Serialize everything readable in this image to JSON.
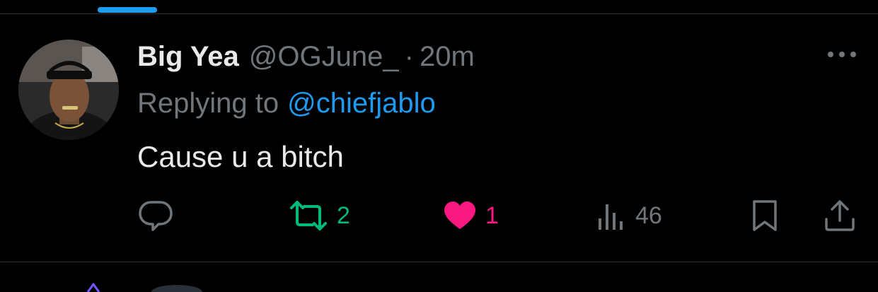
{
  "tweet": {
    "display_name": "Big Yea",
    "handle": "@OGJune_",
    "separator": "·",
    "time": "20m",
    "reply_prefix": "Replying to",
    "reply_mention": "@chiefjablo",
    "text": "Cause u a bitch"
  },
  "actions": {
    "reply": {
      "icon": "reply-icon",
      "count": ""
    },
    "retweet": {
      "icon": "retweet-icon",
      "count": "2"
    },
    "like": {
      "icon": "heart-icon",
      "count": "1"
    },
    "views": {
      "icon": "views-icon",
      "count": "46"
    },
    "bookmark": {
      "icon": "bookmark-icon"
    },
    "share": {
      "icon": "share-icon"
    }
  },
  "colors": {
    "background": "#000000",
    "text_primary": "#e7e9ea",
    "text_secondary": "#71767b",
    "accent": "#1d9bf0",
    "retweet_green": "#00ba7c",
    "like_pink": "#f91880",
    "divider": "#2f3336"
  }
}
